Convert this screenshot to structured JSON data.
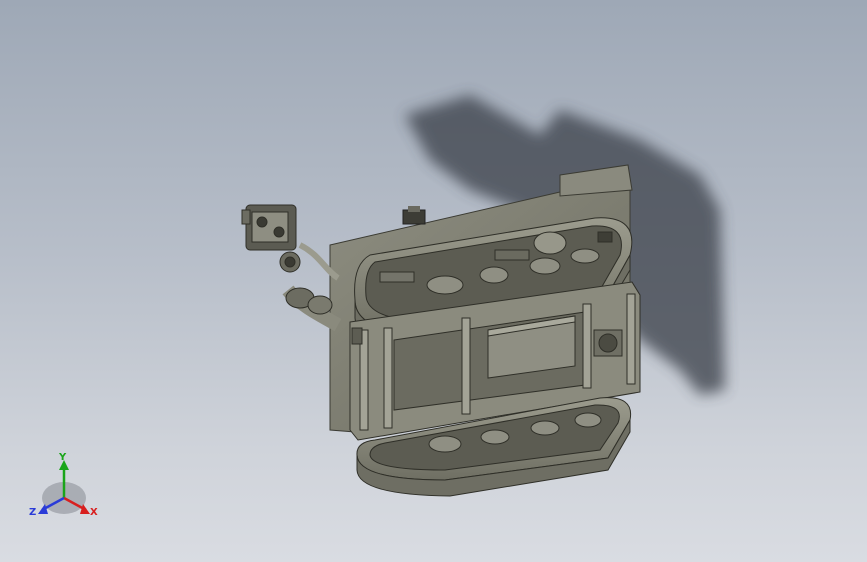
{
  "viewport": {
    "background_top": "#9ea8b6",
    "background_bottom": "#d9dce2"
  },
  "model": {
    "body_color": "#7d7d70",
    "body_dark": "#4e4e44",
    "body_light": "#a7a79a",
    "shadow_color": "#3a3f48"
  },
  "triad": {
    "y_label": "Y",
    "z_label": "Z",
    "x_label": "X",
    "y_color": "#1aa51a",
    "z_color": "#2a3bd8",
    "x_color": "#d81f1f"
  }
}
